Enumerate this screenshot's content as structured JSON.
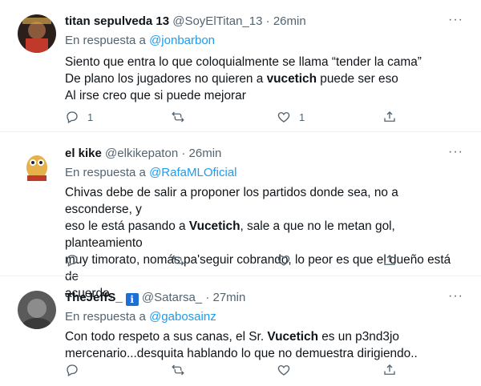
{
  "tweets": [
    {
      "name": "titan sepulveda 13",
      "handle": "@SoyElTitan_13",
      "dot": "·",
      "time": "26min",
      "reply_prefix": "En respuesta a",
      "reply_to": "@jonbarbon",
      "lines": [
        [
          "Siento que entra lo que coloquialmente se llama “tender la cama”"
        ],
        [
          "De plano los jugadores no quieren a ",
          "vucetich",
          " puede ser eso"
        ],
        [
          "Al irse creo que si puede mejorar"
        ]
      ],
      "reply_count": "1",
      "retweet_count": "",
      "like_count": "1"
    },
    {
      "name": "el kike",
      "handle": "@elkikepaton",
      "dot": "·",
      "time": "26min",
      "reply_prefix": "En respuesta a",
      "reply_to": "@RafaMLOficial",
      "lines": [
        [
          "Chivas debe de salir a proponer los partidos donde sea, no a esconderse, y"
        ],
        [
          "eso le está pasando a ",
          "Vucetich",
          ", sale a que no le metan gol, planteamiento"
        ],
        [
          "muy timorato, nomás pa'seguir cobrando, lo peor es que el dueño está de"
        ],
        [
          "acuerdo,"
        ]
      ],
      "reply_count": "",
      "retweet_count": "",
      "like_count": ""
    },
    {
      "name": "TheJeffS_",
      "badge": "i",
      "handle": "@Satarsa_",
      "dot": "·",
      "time": "27min",
      "reply_prefix": "En respuesta a",
      "reply_to": "@gabosainz",
      "lines": [
        [
          "Con todo respeto a sus canas, el Sr. ",
          "Vucetich",
          " es un p3nd3jo"
        ],
        [
          "mercenario...desquita hablando lo que no demuestra dirigiendo.."
        ]
      ],
      "reply_count": "",
      "retweet_count": "",
      "like_count": ""
    }
  ],
  "icons": {
    "more": "more-horizontal-icon",
    "reply": "reply-icon",
    "retweet": "retweet-icon",
    "like": "like-icon",
    "share": "share-icon"
  },
  "more_glyph": "···",
  "colors": {
    "link": "#1d9bf0",
    "muted": "#536471",
    "text": "#0f1419",
    "divider": "#eff3f4"
  }
}
